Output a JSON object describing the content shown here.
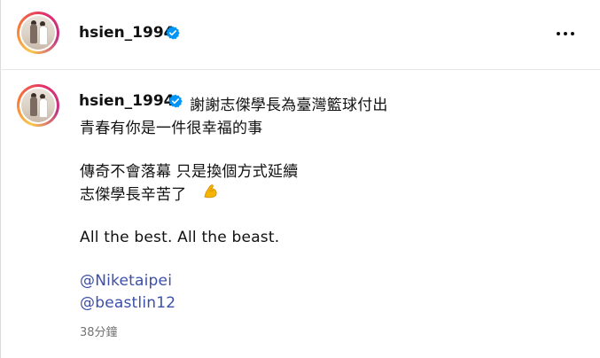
{
  "post": {
    "username": "hsien_1994",
    "more_icon": "more-horizontal-icon"
  },
  "caption": {
    "username": "hsien_1994",
    "lines": [
      "謝謝志傑學長為臺灣籃球付出",
      "青春有你是一件很幸福的事",
      "傳奇不會落幕 只是換個方式延續",
      "志傑學長辛苦了",
      "All the best. All the beast."
    ],
    "emoji": "flexed-biceps-icon",
    "mentions": [
      "@Niketaipei",
      "@beastlin12"
    ],
    "timestamp": "38分鐘"
  },
  "colors": {
    "mention": "#3c4fa8",
    "verified": "#0095f6",
    "muted": "#737373"
  }
}
